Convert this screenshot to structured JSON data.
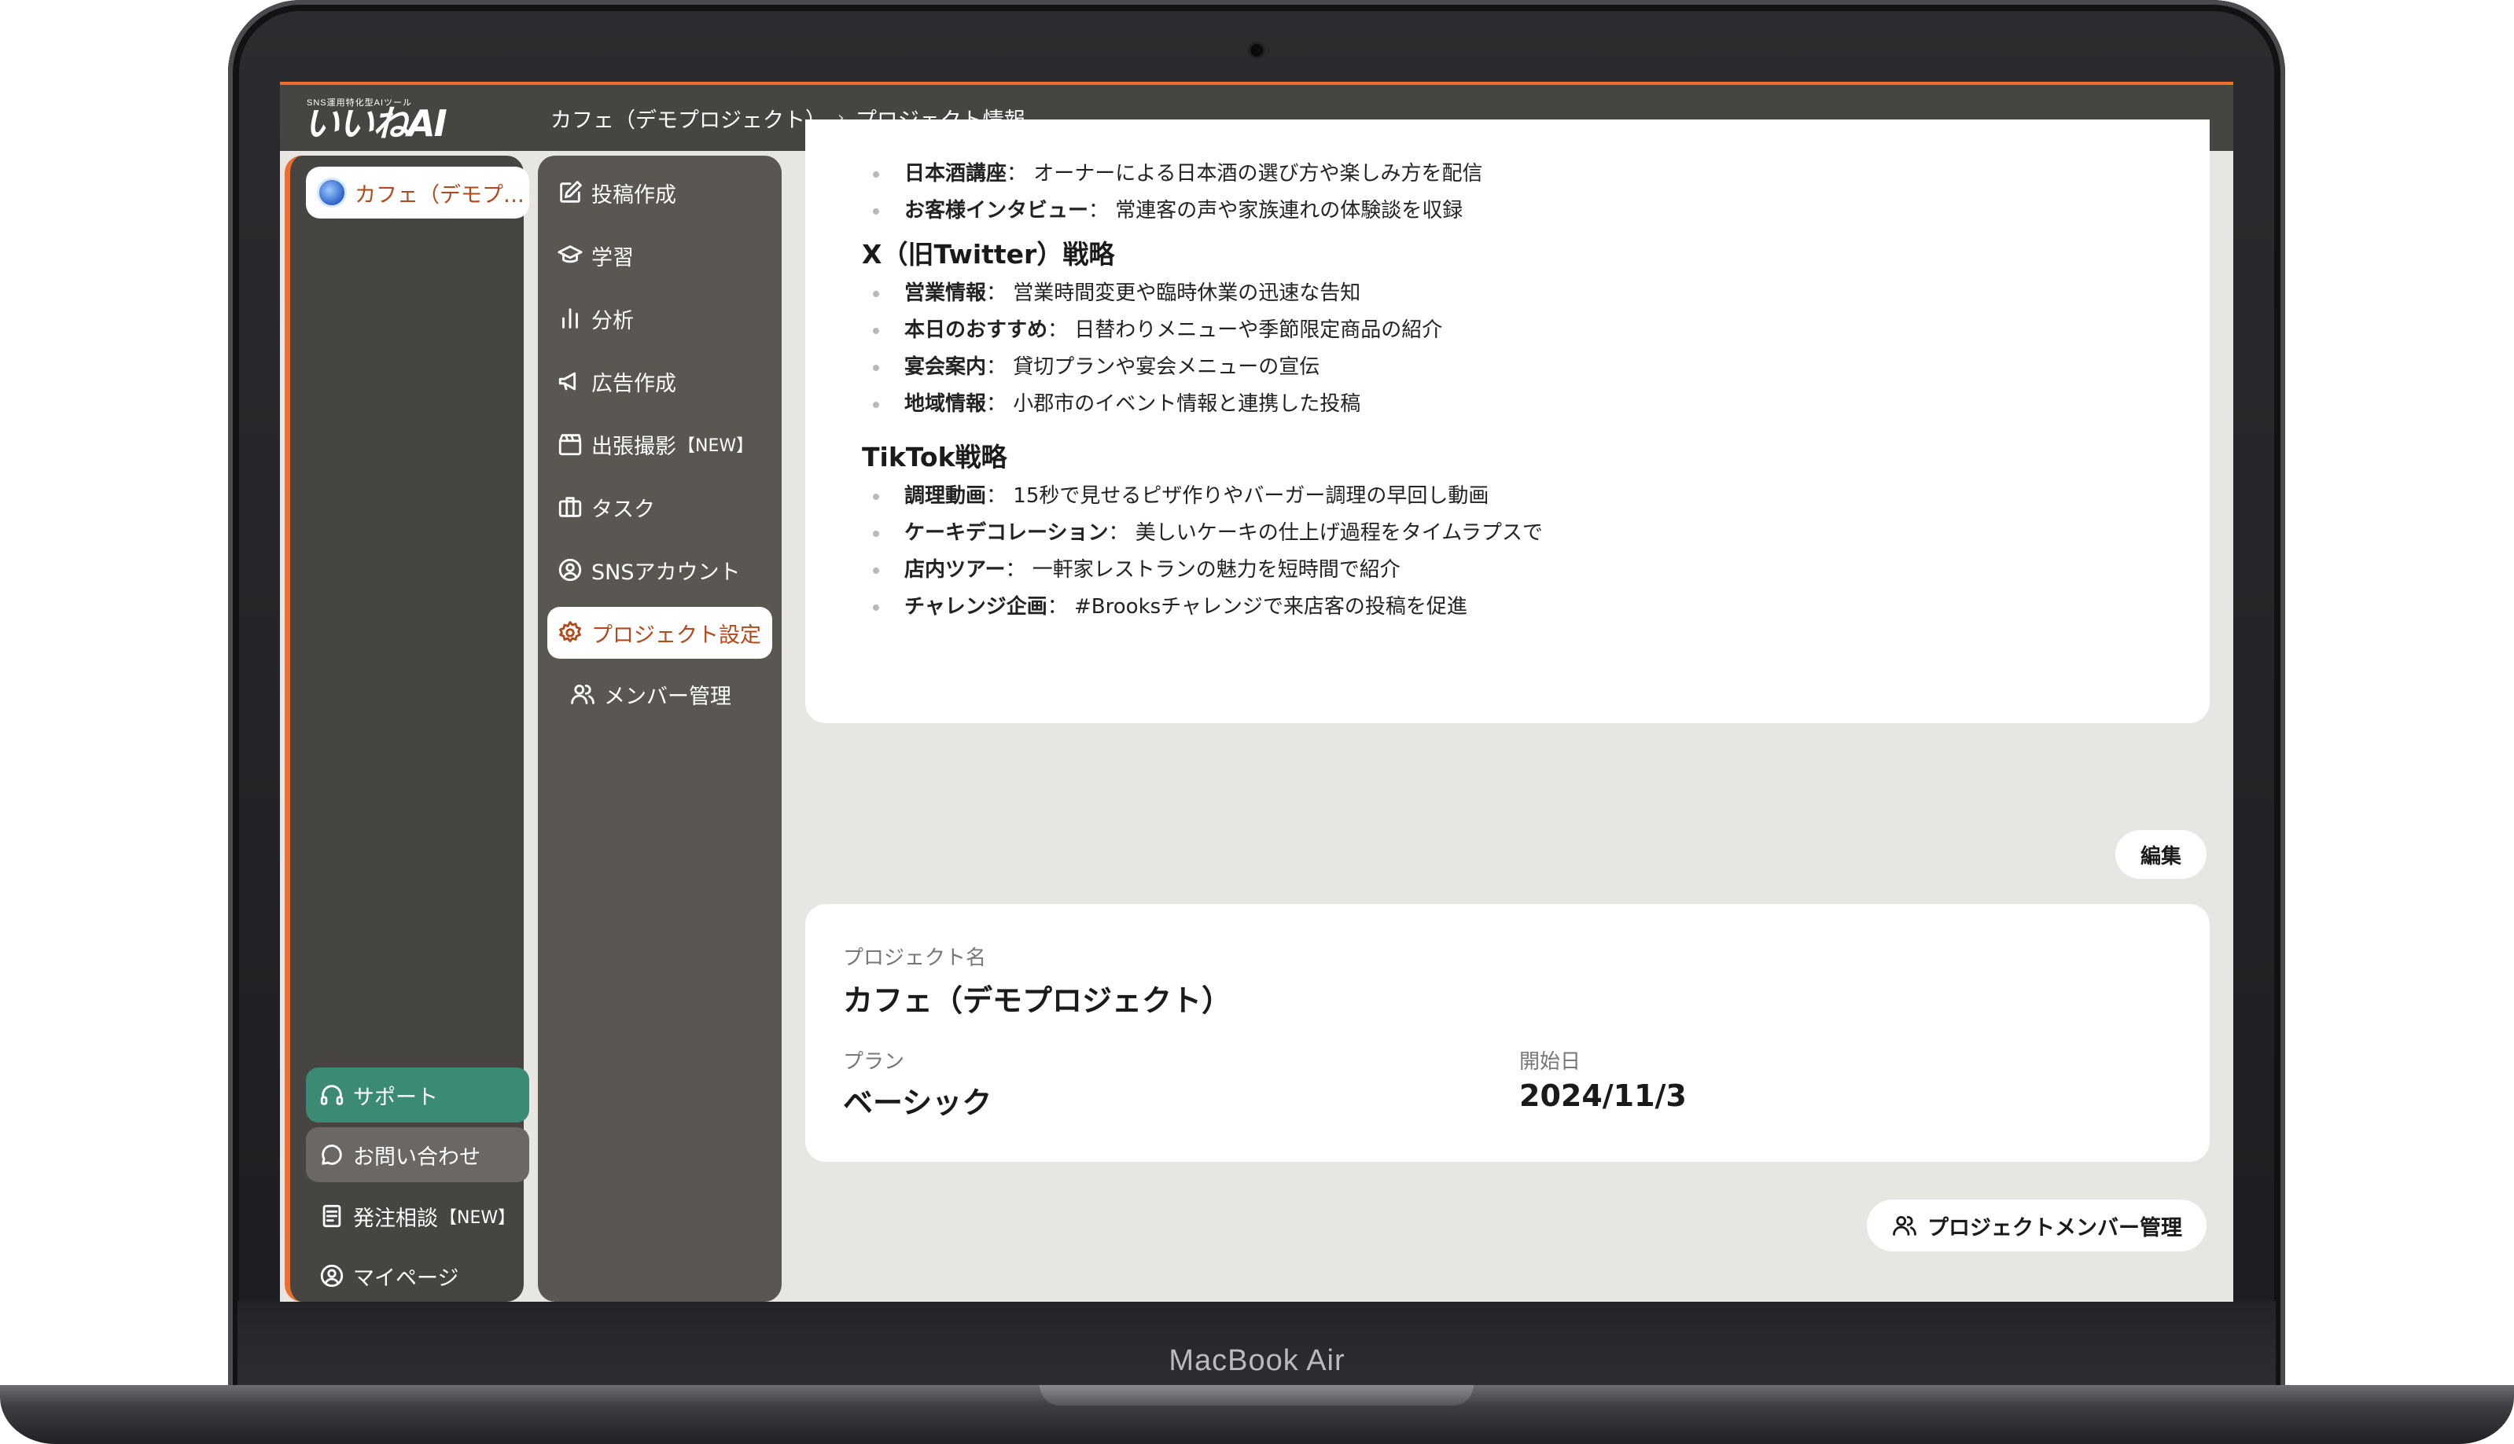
{
  "device": {
    "label": "MacBook Air"
  },
  "header": {
    "logo_tagline": "SNS運用特化型AIツール",
    "logo_text": "いいねAI",
    "breadcrumb": [
      "カフェ（デモプロジェクト）",
      "プロジェクト情報"
    ]
  },
  "left_rail": {
    "project_label": "カフェ（デモプ…",
    "support_label": "サポート",
    "contact_label": "お問い合わせ",
    "order_label": "発注相談",
    "order_badge": "【NEW】",
    "mypage_label": "マイページ"
  },
  "nav": {
    "items": [
      {
        "label": "投稿作成"
      },
      {
        "label": "学習"
      },
      {
        "label": "分析"
      },
      {
        "label": "広告作成"
      },
      {
        "label": "出張撮影",
        "badge": "【NEW】"
      },
      {
        "label": "タスク"
      },
      {
        "label": "SNSアカウント"
      },
      {
        "label": "プロジェクト設定"
      },
      {
        "label": "メンバー管理"
      }
    ]
  },
  "strategy": {
    "top_bullets": [
      {
        "label": "日本酒講座",
        "text": "： オーナーによる日本酒の選び方や楽しみ方を配信"
      },
      {
        "label": "お客様インタビュー",
        "text": "： 常連客の声や家族連れの体験談を収録"
      }
    ],
    "x_title": "X（旧Twitter）戦略",
    "x_bullets": [
      {
        "label": "営業情報",
        "text": "： 営業時間変更や臨時休業の迅速な告知"
      },
      {
        "label": "本日のおすすめ",
        "text": "： 日替わりメニューや季節限定商品の紹介"
      },
      {
        "label": "宴会案内",
        "text": "： 貸切プランや宴会メニューの宣伝"
      },
      {
        "label": "地域情報",
        "text": "： 小郡市のイベント情報と連携した投稿"
      }
    ],
    "tiktok_title": "TikTok戦略",
    "tiktok_bullets": [
      {
        "label": "調理動画",
        "text": "： 15秒で見せるピザ作りやバーガー調理の早回し動画"
      },
      {
        "label": "ケーキデコレーション",
        "text": "： 美しいケーキの仕上げ過程をタイムラプスで"
      },
      {
        "label": "店内ツアー",
        "text": "： 一軒家レストランの魅力を短時間で紹介"
      },
      {
        "label": "チャレンジ企画",
        "text": "： #Brooksチャレンジで来店客の投稿を促進"
      }
    ]
  },
  "actions": {
    "edit_label": "編集",
    "members_label": "プロジェクトメンバー管理"
  },
  "project_info": {
    "name_label": "プロジェクト名",
    "name_value": "カフェ（デモプロジェクト）",
    "plan_label": "プラン",
    "plan_value": "ベーシック",
    "start_label": "開始日",
    "start_value": "2024/11/3"
  },
  "colors": {
    "accent": "#ef6d2d",
    "support": "#3a8a74",
    "sidebar": "#474542",
    "active_text": "#b5481a"
  }
}
